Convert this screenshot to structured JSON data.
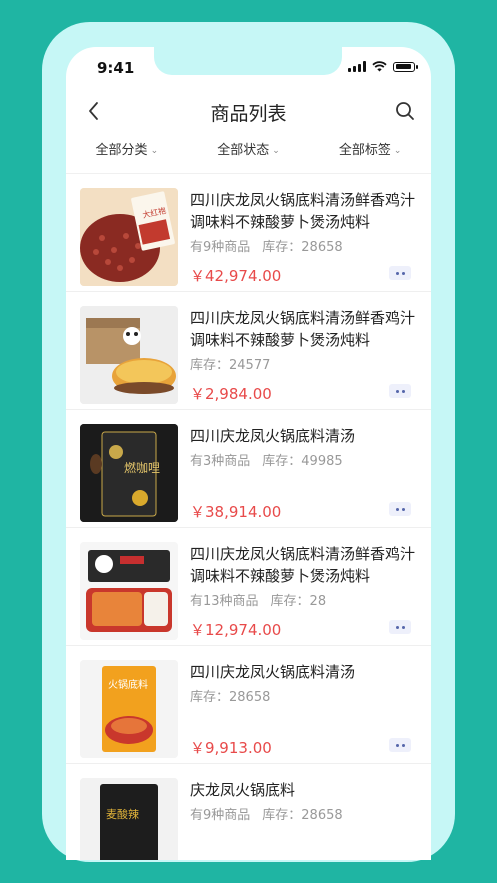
{
  "status": {
    "time": "9:41"
  },
  "nav": {
    "title": "商品列表"
  },
  "filters": [
    "全部分类",
    "全部状态",
    "全部标签"
  ],
  "products": [
    {
      "name": "四川庆龙凤火锅底料清汤鲜香鸡汁调味料不辣酸萝卜煲汤炖料",
      "count": "有9种商品",
      "stock": "库存：28658",
      "price": "￥42,974.00",
      "thumb_text": "大红袍"
    },
    {
      "name": "四川庆龙凤火锅底料清汤鲜香鸡汁调味料不辣酸萝卜煲汤炖料",
      "count": "",
      "stock": "库存：24577",
      "price": "￥2,984.00",
      "thumb_text": ""
    },
    {
      "name": "四川庆龙凤火锅底料清汤",
      "count": "有3种商品",
      "stock": "库存：49985",
      "price": "￥38,914.00",
      "thumb_text": "燃咖哩"
    },
    {
      "name": "四川庆龙凤火锅底料清汤鲜香鸡汁调味料不辣酸萝卜煲汤炖料",
      "count": "有13种商品",
      "stock": "库存：28",
      "price": "￥12,974.00",
      "thumb_text": ""
    },
    {
      "name": "四川庆龙凤火锅底料清汤",
      "count": "",
      "stock": "库存：28658",
      "price": "￥9,913.00",
      "thumb_text": "火锅底料"
    },
    {
      "name": "庆龙凤火锅底料",
      "count": "有9种商品",
      "stock": "库存：28658",
      "price": "",
      "thumb_text": "麦酸辣"
    }
  ]
}
